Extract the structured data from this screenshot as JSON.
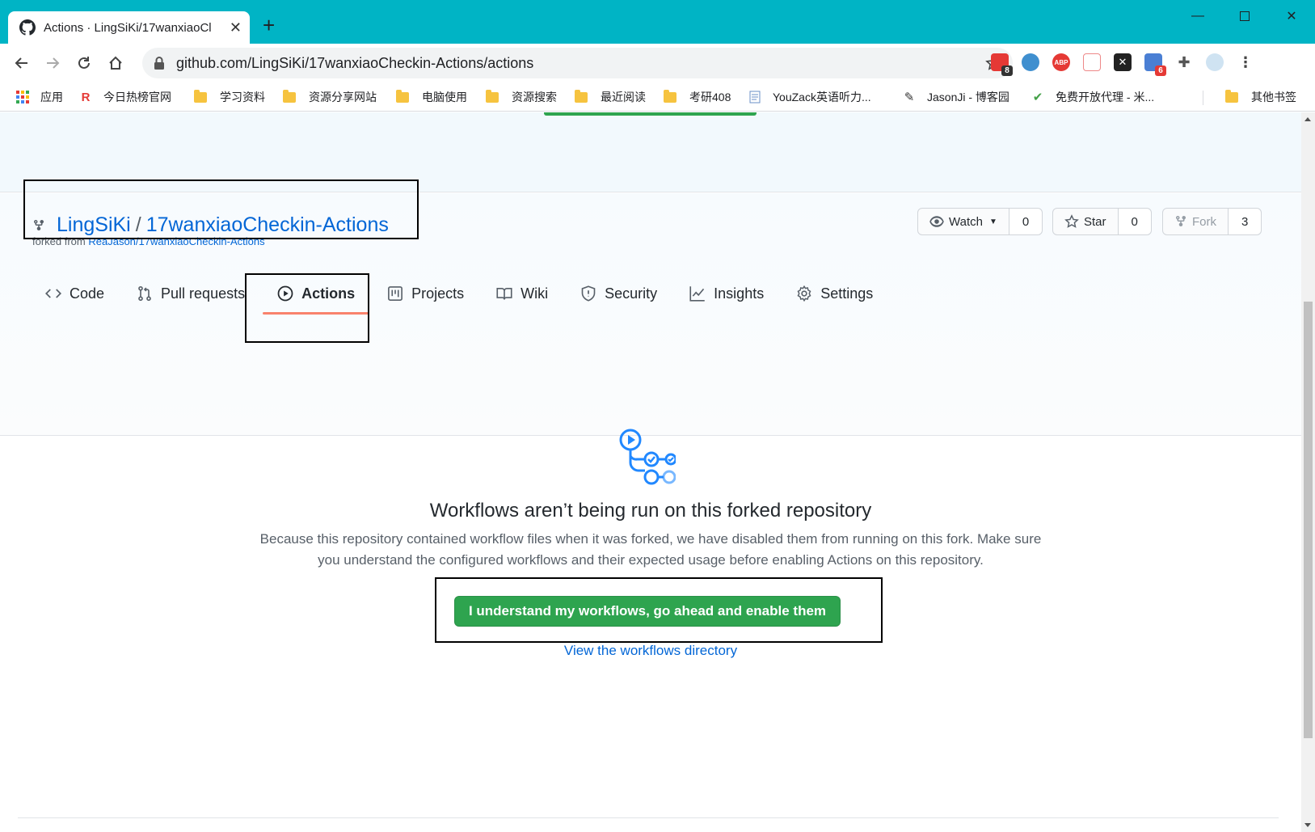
{
  "browser": {
    "tab_title": "Actions · LingSiKi/17wanxiaoCl",
    "url": "github.com/LingSiKi/17wanxiaoCheckin-Actions/actions",
    "extensions": [
      {
        "name": "ext-red",
        "badge": "8"
      },
      {
        "name": "ext-globe",
        "badge": ""
      },
      {
        "name": "adblock-plus",
        "label": "ABP",
        "badge": ""
      },
      {
        "name": "ext-cat",
        "badge": ""
      },
      {
        "name": "ext-x",
        "badge": ""
      },
      {
        "name": "ext-grid",
        "badge": "6"
      }
    ],
    "bookmarks": [
      {
        "label": "应用",
        "icon": "apps-grid-icon"
      },
      {
        "label": "今日热榜官网",
        "icon": "r-logo-icon"
      },
      {
        "label": "学习资料",
        "icon": "folder-icon"
      },
      {
        "label": "资源分享网站",
        "icon": "folder-icon"
      },
      {
        "label": "电脑使用",
        "icon": "folder-icon"
      },
      {
        "label": "资源搜索",
        "icon": "folder-icon"
      },
      {
        "label": "最近阅读",
        "icon": "folder-icon"
      },
      {
        "label": "考研408",
        "icon": "folder-icon"
      },
      {
        "label": "YouZack英语听力...",
        "icon": "page-icon"
      },
      {
        "label": "JasonJi - 博客园",
        "icon": "pen-icon"
      },
      {
        "label": "免费开放代理 - 米...",
        "icon": "check-icon"
      },
      {
        "label": "其他书签",
        "icon": "folder-icon"
      }
    ]
  },
  "repo": {
    "owner": "LingSiKi",
    "separator": "/",
    "name": "17wanxiaoCheckin-Actions",
    "forked_prefix": "forked from ",
    "forked_from": "ReaJason/17wanxiaoCheckin-Actions",
    "watch_label": "Watch",
    "watch_count": "0",
    "star_label": "Star",
    "star_count": "0",
    "fork_label": "Fork",
    "fork_count": "3"
  },
  "nav": {
    "code": "Code",
    "pull_requests": "Pull requests",
    "actions": "Actions",
    "projects": "Projects",
    "wiki": "Wiki",
    "security": "Security",
    "insights": "Insights",
    "settings": "Settings"
  },
  "blankslate": {
    "title": "Workflows aren’t being run on this forked repository",
    "description_line1": "Because this repository contained workflow files when it was forked, we have disabled them from running on this fork. Make sure",
    "description_line2": "you understand the configured workflows and their expected usage before enabling Actions on this repository.",
    "enable_button": "I understand my workflows, go ahead and enable them",
    "view_link": "View the workflows directory"
  },
  "colors": {
    "titlebar": "#00b4c5",
    "link": "#0366d6",
    "primary_button": "#2ea44f",
    "active_tab_underline": "#f9826c"
  }
}
